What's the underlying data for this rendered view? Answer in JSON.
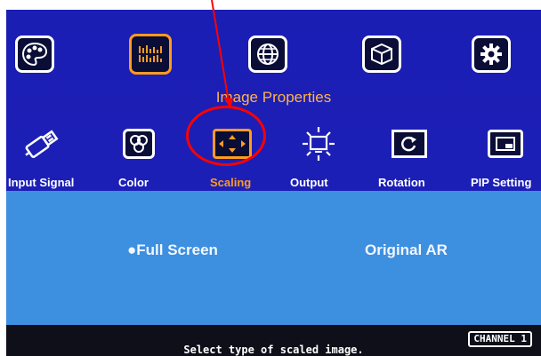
{
  "menu": {
    "top_icons": [
      {
        "icon": "palette-icon",
        "selected": false
      },
      {
        "icon": "image-properties-icon",
        "selected": true
      },
      {
        "icon": "globe-icon",
        "selected": false
      },
      {
        "icon": "3d-cube-icon",
        "selected": false
      },
      {
        "icon": "gear-icon",
        "selected": false
      }
    ],
    "section_title": "Image Properties",
    "sub_items": [
      {
        "label": "Input Signal",
        "icon": "usb-plug-icon",
        "selected": false
      },
      {
        "label": "Color",
        "icon": "color-circles-icon",
        "selected": false
      },
      {
        "label": "Scaling",
        "icon": "scaling-arrows-icon",
        "selected": true
      },
      {
        "label": "Output",
        "icon": "sun-monitor-icon",
        "selected": false
      },
      {
        "label": "Rotation",
        "icon": "rotation-icon",
        "selected": false
      },
      {
        "label": "PIP Setting",
        "icon": "pip-window-icon",
        "selected": false
      }
    ]
  },
  "options": {
    "full_screen": "●Full Screen",
    "original_ar": "Original AR",
    "selected": "Full Screen"
  },
  "footer": {
    "hint": "Select type of scaled image.",
    "channel": "CHANNEL 1"
  },
  "colors": {
    "menu_bg": "#1b1eb3",
    "panel_bg": "#3d8fe0",
    "selected_accent": "#ff9b1f",
    "annotation": "#ff0000"
  }
}
